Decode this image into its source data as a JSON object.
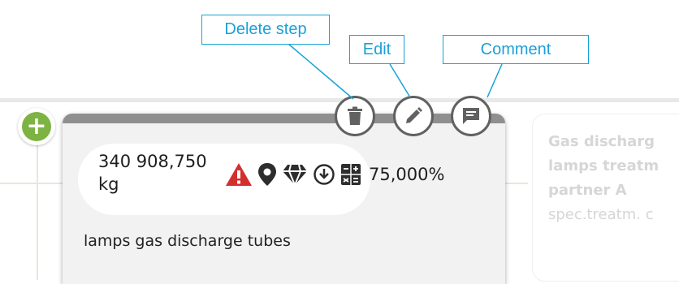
{
  "card": {
    "weight_line1": "340 908,750",
    "weight_line2": "kg",
    "percentage": "75,000%",
    "description": "lamps gas discharge tubes",
    "icons": [
      "warning-icon",
      "location-pin-icon",
      "diamond-icon",
      "download-circle-icon",
      "calculator-icon"
    ]
  },
  "actions": [
    {
      "name": "delete",
      "icon": "trash-icon"
    },
    {
      "name": "edit",
      "icon": "pencil-icon"
    },
    {
      "name": "comment",
      "icon": "comment-icon"
    }
  ],
  "callouts": {
    "delete": "Delete step",
    "edit": "Edit",
    "comment": "Comment"
  },
  "next_card": {
    "line1": "Gas discharg",
    "line2": "lamps treatm",
    "line3": "partner A",
    "line4": "spec.treatm. c"
  },
  "colors": {
    "callout_border": "#17a2d6",
    "add_button": "#7cb342",
    "warning": "#d32f2f",
    "card_header": "#8f8f8f"
  }
}
